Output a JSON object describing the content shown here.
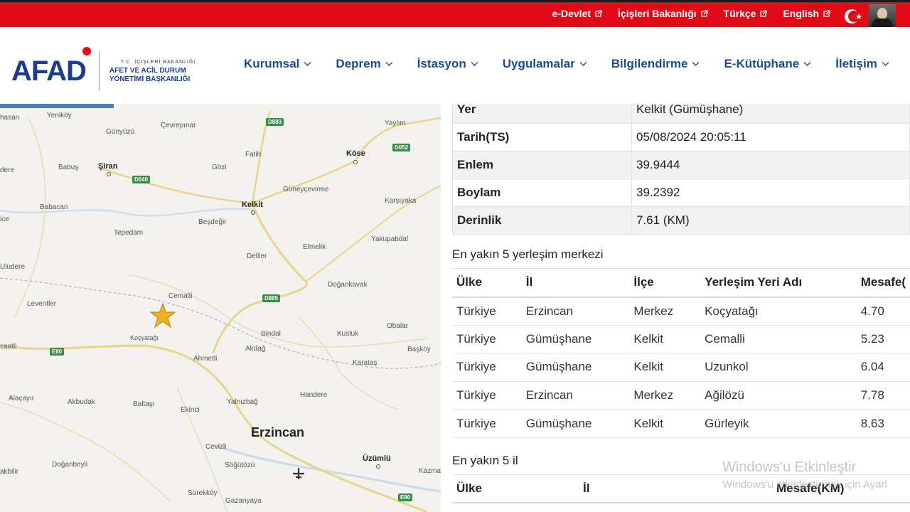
{
  "topbar": {
    "links": [
      {
        "label": "e-Devlet"
      },
      {
        "label": "İçişleri Bakanlığı"
      },
      {
        "label": "Türkçe"
      },
      {
        "label": "English"
      }
    ]
  },
  "logo": {
    "mark": "AFAD",
    "line1": "T.C. İÇİŞLERİ BAKANLIĞI",
    "line2": "AFET VE ACİL DURUM",
    "line3": "YÖNETİMİ BAŞKANLIĞI"
  },
  "nav": {
    "items": [
      {
        "label": "Kurumsal"
      },
      {
        "label": "Deprem"
      },
      {
        "label": "İstasyon"
      },
      {
        "label": "Uygulamalar"
      },
      {
        "label": "Bilgilendirme"
      },
      {
        "label": "E-Kütüphane"
      },
      {
        "label": "İletişim"
      }
    ]
  },
  "map": {
    "labels": {
      "hasan": "hasan",
      "yenikoy": "Yeniköy",
      "cevrepinar": "Çevrepınar",
      "yaylim": "Yaylım",
      "gunyuzu": "Günyüzü",
      "fatih": "Fatih",
      "kose": "Köse",
      "dere": "dere",
      "babus": "Babuş",
      "siran": "Şiran",
      "gozi": "Gözi",
      "guneycevirme": "Güneyçevirme",
      "karsiyaka": "Karşıyaka",
      "babacan": "Babacan",
      "kelkit": "Kelkit",
      "ice": "ice",
      "besdegir": "Beşdeğir",
      "tepedam": "Tepedam",
      "yakupabdal": "Yakupabdal",
      "elmelik": "Elmelik",
      "uludere": "Uludere",
      "deliler": "Deliler",
      "dogankavak": "Doğankavak",
      "cemalli": "Cemalli",
      "leventler": "Leventler",
      "kocyatagi": "Koçyatağı",
      "bindal": "Bindal",
      "kusluk": "Kusluk",
      "obalar": "Obalar",
      "caatli": "caatli",
      "ahmetli": "Ahmetli",
      "akdag": "Akdağ",
      "karatas": "Karataş",
      "baskoy": "Başköy",
      "alacayir": "Alaçayır",
      "akbudak": "Akbudak",
      "baltasi": "Baltaşı",
      "ekinci": "Ekinci",
      "handere": "Handere",
      "yalnizbag": "Yalnızbağ",
      "erzincan": "Erzincan",
      "cevizli": "Cevizli",
      "uzumlu": "Üzümlü",
      "akbilir": "akbilir",
      "doganbeyli": "Doğanbeyli",
      "sogutozu": "Söğütözü",
      "kazma": "Kazma",
      "surekkoy": "Sürekköy",
      "gazanyaya": "Gazanyaya"
    },
    "roads": {
      "d883": "D883",
      "d052": "D052",
      "d040": "D040",
      "d885": "D885",
      "e80a": "E80",
      "e80b": "E80"
    }
  },
  "details": {
    "rows": [
      {
        "key": "Yer",
        "value": "Kelkit (Gümüşhane)"
      },
      {
        "key": "Tarih(TS)",
        "value": "05/08/2024 20:05:11"
      },
      {
        "key": "Enlem",
        "value": "39.9444"
      },
      {
        "key": "Boylam",
        "value": "39.2392"
      },
      {
        "key": "Derinlik",
        "value": "7.61 (KM)"
      }
    ]
  },
  "nearest_places": {
    "title": "En yakın 5 yerleşim merkezi",
    "headers": {
      "country": "Ülke",
      "province": "İl",
      "district": "İlçe",
      "place": "Yerleşim Yeri Adı",
      "distance": "Mesafe("
    },
    "rows": [
      {
        "country": "Türkiye",
        "province": "Erzincan",
        "district": "Merkez",
        "place": "Koçyatağı",
        "distance": "4.70"
      },
      {
        "country": "Türkiye",
        "province": "Gümüşhane",
        "district": "Kelkit",
        "place": "Cemalli",
        "distance": "5.23"
      },
      {
        "country": "Türkiye",
        "province": "Gümüşhane",
        "district": "Kelkit",
        "place": "Uzunkol",
        "distance": "6.04"
      },
      {
        "country": "Türkiye",
        "province": "Erzincan",
        "district": "Merkez",
        "place": "Ağilözü",
        "distance": "7.78"
      },
      {
        "country": "Türkiye",
        "province": "Gümüşhane",
        "district": "Kelkit",
        "place": "Gürleyik",
        "distance": "8.63"
      }
    ]
  },
  "nearest_provinces": {
    "title": "En yakın 5 il",
    "headers": {
      "country": "Ülke",
      "province": "İl",
      "distance": "Mesafe(KM)"
    }
  },
  "watermark": {
    "line1": "Windows'u Etkinleştir",
    "line2": "Windows'u etkinleştirmek için Ayarl"
  }
}
